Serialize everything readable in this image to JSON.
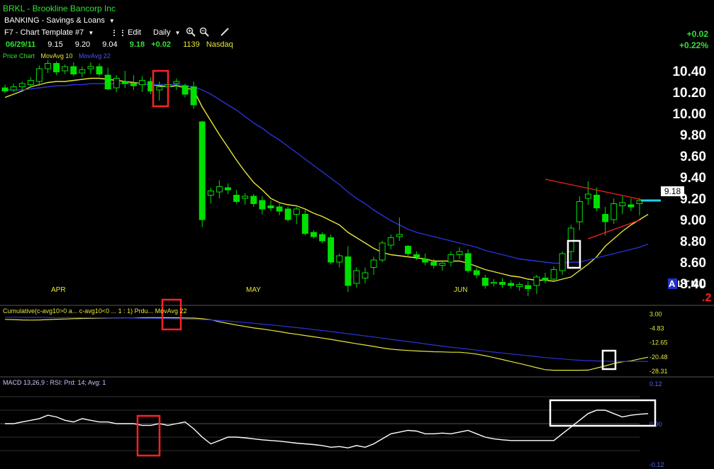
{
  "header": {
    "symbol_title": "BRKL  - Brookline Bancorp Inc",
    "sector": "BANKING - Savings & Loans",
    "template": "F7 - Chart Template #7",
    "edit_label": "Edit",
    "period": "Daily",
    "quote": {
      "date": "06/29/11",
      "open": "9.15",
      "high": "9.20",
      "low": "9.04",
      "close": "9.18",
      "change": "+0.02",
      "volume": "1139",
      "exchange": "Nasdaq"
    },
    "change_abs": "+0.02",
    "change_pct": "+0.22%"
  },
  "price_panel": {
    "legend_price": "Price Chart",
    "legend_ma10": "MovAvg 10",
    "legend_ma22": "MovAvg 22",
    "price_tag": "9.18",
    "month_labels": [
      "APR",
      "MAY",
      "JUN"
    ],
    "scale_buttons": [
      "A",
      "L",
      "T",
      "M",
      "L"
    ],
    "corner_value": ".2"
  },
  "cumulative_panel": {
    "label_text": "Cumulative(c-avg10>0 a... c-avg10<0 ... 1 : 1) Prdu... MovAvg 22",
    "axis_labels": [
      "3.00",
      "-4.83",
      "-12.65",
      "-20.48",
      "-28.31"
    ]
  },
  "macd_panel": {
    "label_text": "MACD 13,26,9 : RSI: Prd: 14; Avg: 1",
    "axis_labels": [
      "0.12",
      "0.00",
      "-0.12"
    ]
  },
  "colors": {
    "up_candle": "#00e000",
    "ma10": "#e6e63a",
    "ma22": "#2a33d6",
    "trendline": "#ff2020",
    "highlight_red": "#ff2222",
    "highlight_white": "#ffffff",
    "price_tag_line": "#22ccee",
    "macd_line": "#ffffff"
  },
  "chart_data": [
    {
      "type": "candlestick",
      "title": "BRKL  - Brookline Bancorp Inc",
      "y_ticks": [
        "10.40",
        "10.20",
        "10.00",
        "9.80",
        "9.60",
        "9.40",
        "9.20",
        "9.00",
        "8.80",
        "8.60",
        "8.40"
      ],
      "ylim": [
        8.3,
        10.5
      ],
      "x_ticks": [
        "APR",
        "MAY",
        "JUN"
      ],
      "candles": [
        {
          "o": 10.24,
          "h": 10.27,
          "l": 10.19,
          "c": 10.21
        },
        {
          "o": 10.22,
          "h": 10.28,
          "l": 10.2,
          "c": 10.25
        },
        {
          "o": 10.25,
          "h": 10.3,
          "l": 10.22,
          "c": 10.28
        },
        {
          "o": 10.27,
          "h": 10.34,
          "l": 10.24,
          "c": 10.31
        },
        {
          "o": 10.3,
          "h": 10.45,
          "l": 10.26,
          "c": 10.42
        },
        {
          "o": 10.42,
          "h": 10.5,
          "l": 10.38,
          "c": 10.47
        },
        {
          "o": 10.47,
          "h": 10.49,
          "l": 10.36,
          "c": 10.39
        },
        {
          "o": 10.4,
          "h": 10.46,
          "l": 10.37,
          "c": 10.44
        },
        {
          "o": 10.44,
          "h": 10.48,
          "l": 10.35,
          "c": 10.37
        },
        {
          "o": 10.38,
          "h": 10.44,
          "l": 10.34,
          "c": 10.41
        },
        {
          "o": 10.42,
          "h": 10.48,
          "l": 10.37,
          "c": 10.44
        },
        {
          "o": 10.44,
          "h": 10.47,
          "l": 10.35,
          "c": 10.37
        },
        {
          "o": 10.36,
          "h": 10.43,
          "l": 10.22,
          "c": 10.23
        },
        {
          "o": 10.24,
          "h": 10.36,
          "l": 10.2,
          "c": 10.33
        },
        {
          "o": 10.3,
          "h": 10.4,
          "l": 10.24,
          "c": 10.28
        },
        {
          "o": 10.28,
          "h": 10.36,
          "l": 10.22,
          "c": 10.26
        },
        {
          "o": 10.27,
          "h": 10.35,
          "l": 10.2,
          "c": 10.31
        },
        {
          "o": 10.3,
          "h": 10.34,
          "l": 10.18,
          "c": 10.21
        },
        {
          "o": 10.22,
          "h": 10.3,
          "l": 10.12,
          "c": 10.25
        },
        {
          "o": 10.25,
          "h": 10.36,
          "l": 10.2,
          "c": 10.27
        },
        {
          "o": 10.28,
          "h": 10.33,
          "l": 10.22,
          "c": 10.3
        },
        {
          "o": 10.26,
          "h": 10.28,
          "l": 10.15,
          "c": 10.18
        },
        {
          "o": 10.25,
          "h": 10.3,
          "l": 10.04,
          "c": 10.08
        },
        {
          "o": 9.92,
          "h": 9.93,
          "l": 8.93,
          "c": 9.0
        },
        {
          "o": 9.23,
          "h": 9.3,
          "l": 9.15,
          "c": 9.27
        },
        {
          "o": 9.26,
          "h": 9.37,
          "l": 9.2,
          "c": 9.31
        },
        {
          "o": 9.3,
          "h": 9.34,
          "l": 9.24,
          "c": 9.28
        },
        {
          "o": 9.23,
          "h": 9.28,
          "l": 9.15,
          "c": 9.17
        },
        {
          "o": 9.2,
          "h": 9.25,
          "l": 9.14,
          "c": 9.22
        },
        {
          "o": 9.22,
          "h": 9.24,
          "l": 9.12,
          "c": 9.15
        },
        {
          "o": 9.18,
          "h": 9.22,
          "l": 9.05,
          "c": 9.1
        },
        {
          "o": 9.13,
          "h": 9.18,
          "l": 9.08,
          "c": 9.11
        },
        {
          "o": 9.12,
          "h": 9.15,
          "l": 9.04,
          "c": 9.08
        },
        {
          "o": 9.1,
          "h": 9.12,
          "l": 8.98,
          "c": 9.0
        },
        {
          "o": 9.05,
          "h": 9.12,
          "l": 8.96,
          "c": 9.1
        },
        {
          "o": 9.05,
          "h": 9.09,
          "l": 8.85,
          "c": 8.87
        },
        {
          "o": 8.88,
          "h": 8.9,
          "l": 8.82,
          "c": 8.84
        },
        {
          "o": 8.86,
          "h": 8.88,
          "l": 8.78,
          "c": 8.8
        },
        {
          "o": 8.83,
          "h": 8.86,
          "l": 8.58,
          "c": 8.6
        },
        {
          "o": 8.6,
          "h": 8.68,
          "l": 8.55,
          "c": 8.66
        },
        {
          "o": 8.65,
          "h": 8.75,
          "l": 8.32,
          "c": 8.38
        },
        {
          "o": 8.4,
          "h": 8.55,
          "l": 8.36,
          "c": 8.52
        },
        {
          "o": 8.45,
          "h": 8.55,
          "l": 8.4,
          "c": 8.5
        },
        {
          "o": 8.55,
          "h": 8.65,
          "l": 8.48,
          "c": 8.62
        },
        {
          "o": 8.62,
          "h": 8.8,
          "l": 8.6,
          "c": 8.78
        },
        {
          "o": 8.76,
          "h": 8.86,
          "l": 8.72,
          "c": 8.83
        },
        {
          "o": 8.84,
          "h": 9.02,
          "l": 8.8,
          "c": 8.86
        },
        {
          "o": 8.75,
          "h": 8.76,
          "l": 8.66,
          "c": 8.68
        },
        {
          "o": 8.67,
          "h": 8.7,
          "l": 8.62,
          "c": 8.65
        },
        {
          "o": 8.63,
          "h": 8.68,
          "l": 8.57,
          "c": 8.6
        },
        {
          "o": 8.6,
          "h": 8.63,
          "l": 8.54,
          "c": 8.57
        },
        {
          "o": 8.57,
          "h": 8.61,
          "l": 8.52,
          "c": 8.59
        },
        {
          "o": 8.6,
          "h": 8.7,
          "l": 8.56,
          "c": 8.67
        },
        {
          "o": 8.67,
          "h": 8.74,
          "l": 8.63,
          "c": 8.7
        },
        {
          "o": 8.68,
          "h": 8.72,
          "l": 8.5,
          "c": 8.52
        },
        {
          "o": 8.52,
          "h": 8.55,
          "l": 8.45,
          "c": 8.48
        },
        {
          "o": 8.45,
          "h": 8.48,
          "l": 8.35,
          "c": 8.38
        },
        {
          "o": 8.4,
          "h": 8.44,
          "l": 8.37,
          "c": 8.41
        },
        {
          "o": 8.41,
          "h": 8.45,
          "l": 8.36,
          "c": 8.39
        },
        {
          "o": 8.4,
          "h": 8.43,
          "l": 8.35,
          "c": 8.38
        },
        {
          "o": 8.37,
          "h": 8.41,
          "l": 8.33,
          "c": 8.39
        },
        {
          "o": 8.38,
          "h": 8.42,
          "l": 8.28,
          "c": 8.35
        },
        {
          "o": 8.38,
          "h": 8.48,
          "l": 8.3,
          "c": 8.46
        },
        {
          "o": 8.45,
          "h": 8.5,
          "l": 8.4,
          "c": 8.43
        },
        {
          "o": 8.44,
          "h": 8.56,
          "l": 8.42,
          "c": 8.53
        },
        {
          "o": 8.52,
          "h": 8.7,
          "l": 8.48,
          "c": 8.68
        },
        {
          "o": 8.7,
          "h": 8.95,
          "l": 8.62,
          "c": 8.92
        },
        {
          "o": 8.98,
          "h": 9.22,
          "l": 8.9,
          "c": 9.17
        },
        {
          "o": 9.2,
          "h": 9.36,
          "l": 9.14,
          "c": 9.24
        },
        {
          "o": 9.23,
          "h": 9.3,
          "l": 9.08,
          "c": 9.11
        },
        {
          "o": 9.05,
          "h": 9.12,
          "l": 8.85,
          "c": 8.98
        },
        {
          "o": 9.0,
          "h": 9.2,
          "l": 8.96,
          "c": 9.15
        },
        {
          "o": 9.13,
          "h": 9.22,
          "l": 9.05,
          "c": 9.16
        },
        {
          "o": 9.14,
          "h": 9.2,
          "l": 9.08,
          "c": 9.12
        },
        {
          "o": 9.15,
          "h": 9.2,
          "l": 9.04,
          "c": 9.18
        }
      ],
      "series": [
        {
          "name": "MovAvg 10",
          "values": [
            10.15,
            10.18,
            10.21,
            10.25,
            10.27,
            10.29,
            10.3,
            10.3,
            10.31,
            10.32,
            10.33,
            10.33,
            10.32,
            10.31,
            10.3,
            10.29,
            10.28,
            10.27,
            10.26,
            10.25,
            10.26,
            10.24,
            10.22,
            10.06,
            9.93,
            9.8,
            9.68,
            9.56,
            9.45,
            9.35,
            9.28,
            9.2,
            9.16,
            9.14,
            9.13,
            9.1,
            9.06,
            9.03,
            8.99,
            8.95,
            8.88,
            8.83,
            8.78,
            8.73,
            8.69,
            8.67,
            8.66,
            8.65,
            8.64,
            8.63,
            8.61,
            8.61,
            8.61,
            8.61,
            8.59,
            8.56,
            8.53,
            8.51,
            8.49,
            8.47,
            8.46,
            8.44,
            8.43,
            8.43,
            8.42,
            8.44,
            8.46,
            8.52,
            8.58,
            8.65,
            8.75,
            8.82,
            8.89,
            8.95,
            9.0,
            9.05
          ]
        },
        {
          "name": "MovAvg 22",
          "values": [
            10.22,
            10.22,
            10.22,
            10.23,
            10.24,
            10.25,
            10.26,
            10.26,
            10.27,
            10.27,
            10.28,
            10.28,
            10.28,
            10.28,
            10.28,
            10.28,
            10.28,
            10.27,
            10.27,
            10.27,
            10.27,
            10.26,
            10.25,
            10.22,
            10.18,
            10.13,
            10.08,
            10.03,
            9.97,
            9.91,
            9.86,
            9.8,
            9.75,
            9.69,
            9.63,
            9.57,
            9.51,
            9.45,
            9.39,
            9.33,
            9.26,
            9.2,
            9.15,
            9.09,
            9.04,
            8.99,
            8.95,
            8.91,
            8.88,
            8.86,
            8.84,
            8.82,
            8.8,
            8.78,
            8.76,
            8.74,
            8.71,
            8.69,
            8.67,
            8.65,
            8.63,
            8.62,
            8.61,
            8.6,
            8.59,
            8.59,
            8.6,
            8.6,
            8.62,
            8.64,
            8.66,
            8.68,
            8.7,
            8.72,
            8.74,
            8.77
          ]
        }
      ]
    },
    {
      "type": "line",
      "y_ticks": [
        "3.00",
        "-4.83",
        "-12.65",
        "-20.48",
        "-28.31"
      ],
      "ylim": [
        -30.3,
        4.8
      ],
      "series": [
        {
          "name": "Cumulative",
          "values": [
            -0.2,
            -0.3,
            -0.5,
            -0.6,
            -0.5,
            -0.3,
            -0.1,
            0.0,
            0.2,
            0.3,
            0.4,
            0.5,
            0.5,
            0.6,
            0.6,
            0.6,
            0.7,
            0.8,
            0.8,
            0.7,
            0.7,
            0.6,
            0.5,
            0.2,
            -0.4,
            -1.5,
            -2.4,
            -3.3,
            -4.1,
            -4.9,
            -5.5,
            -6.2,
            -6.9,
            -7.7,
            -8.4,
            -9.1,
            -9.8,
            -10.5,
            -11.2,
            -12.0,
            -12.8,
            -13.6,
            -14.3,
            -15.1,
            -15.9,
            -16.6,
            -17.0,
            -17.3,
            -17.6,
            -17.8,
            -18.0,
            -18.1,
            -18.3,
            -18.3,
            -18.7,
            -19.3,
            -20.2,
            -21.2,
            -22.3,
            -23.4,
            -24.5,
            -25.6,
            -26.8,
            -27.9,
            -28.2,
            -28.2,
            -28.2,
            -28.2,
            -28.1,
            -27.0,
            -25.8,
            -24.5,
            -23.5,
            -23.0,
            -22.0,
            -21.0
          ]
        },
        {
          "name": "MovAvg 22",
          "values": [
            1.0,
            1.0,
            0.9,
            0.9,
            0.9,
            0.9,
            0.8,
            0.8,
            0.8,
            0.7,
            0.7,
            0.7,
            0.6,
            0.6,
            0.6,
            0.5,
            0.4,
            0.4,
            0.3,
            0.2,
            0.1,
            0.0,
            -0.1,
            -0.3,
            -0.5,
            -0.8,
            -1.1,
            -1.5,
            -1.9,
            -2.3,
            -2.8,
            -3.2,
            -3.7,
            -4.2,
            -4.7,
            -5.2,
            -5.8,
            -6.3,
            -6.9,
            -7.5,
            -8.1,
            -8.7,
            -9.3,
            -9.9,
            -10.5,
            -11.2,
            -11.8,
            -12.4,
            -13.0,
            -13.7,
            -14.3,
            -14.9,
            -15.5,
            -16.0,
            -16.6,
            -17.1,
            -17.7,
            -18.2,
            -18.7,
            -19.2,
            -19.7,
            -20.2,
            -20.7,
            -21.2,
            -21.6,
            -22.0,
            -22.4,
            -22.7,
            -22.9,
            -23.1,
            -23.2,
            -23.3,
            -23.3,
            -23.3,
            -23.3,
            -23.3
          ]
        }
      ]
    },
    {
      "type": "line",
      "y_ticks": [
        "0.12",
        "0.00",
        "-0.12"
      ],
      "ylim": [
        -0.12,
        0.12
      ],
      "series": [
        {
          "name": "MACD",
          "values": [
            0.0,
            0.0,
            0.005,
            0.01,
            0.015,
            0.025,
            0.02,
            0.01,
            0.005,
            0.015,
            0.01,
            0.005,
            0.005,
            0.0,
            0.0,
            0.0,
            -0.005,
            -0.005,
            0.0,
            -0.005,
            0.0,
            0.005,
            -0.015,
            -0.04,
            -0.06,
            -0.05,
            -0.04,
            -0.04,
            -0.042,
            -0.045,
            -0.048,
            -0.05,
            -0.052,
            -0.055,
            -0.058,
            -0.06,
            -0.062,
            -0.065,
            -0.07,
            -0.068,
            -0.072,
            -0.065,
            -0.07,
            -0.06,
            -0.045,
            -0.03,
            -0.025,
            -0.02,
            -0.022,
            -0.03,
            -0.03,
            -0.028,
            -0.03,
            -0.025,
            -0.02,
            -0.03,
            -0.04,
            -0.045,
            -0.048,
            -0.05,
            -0.05,
            -0.05,
            -0.05,
            -0.05,
            -0.05,
            -0.03,
            -0.01,
            0.01,
            0.03,
            0.04,
            0.04,
            0.03,
            0.02,
            0.025,
            0.028,
            0.03
          ]
        }
      ]
    }
  ]
}
